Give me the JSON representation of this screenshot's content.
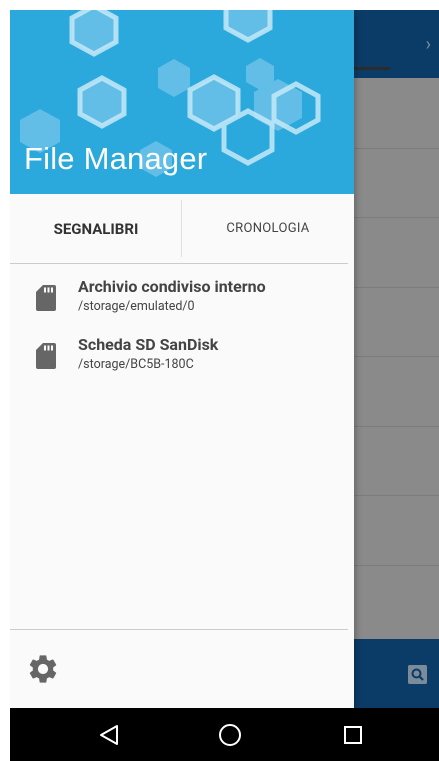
{
  "drawer": {
    "header_title": "File Manager",
    "tabs": [
      {
        "label": "SEGNALIBRI",
        "active": true
      },
      {
        "label": "CRONOLOGIA",
        "active": false
      }
    ],
    "storages": [
      {
        "title": "Archivio condiviso interno",
        "path": "/storage/emulated/0",
        "icon": "sd-card-icon"
      },
      {
        "title": "Scheda SD SanDisk",
        "path": "/storage/BC5B-180C",
        "icon": "sd-card-icon"
      }
    ],
    "footer": {
      "settings_icon": "gear-icon"
    }
  },
  "background_app": {
    "toolbar_chevron": "›",
    "search_icon": "search-icon"
  },
  "system_nav": {
    "back_icon": "back-triangle-icon",
    "home_icon": "home-circle-icon",
    "recents_icon": "recents-square-icon"
  },
  "colors": {
    "header_blue": "#2ba8dc",
    "app_bar_navy": "#0b3c68",
    "scrim_gray": "#8a8a8a",
    "icon_gray": "#666666"
  }
}
